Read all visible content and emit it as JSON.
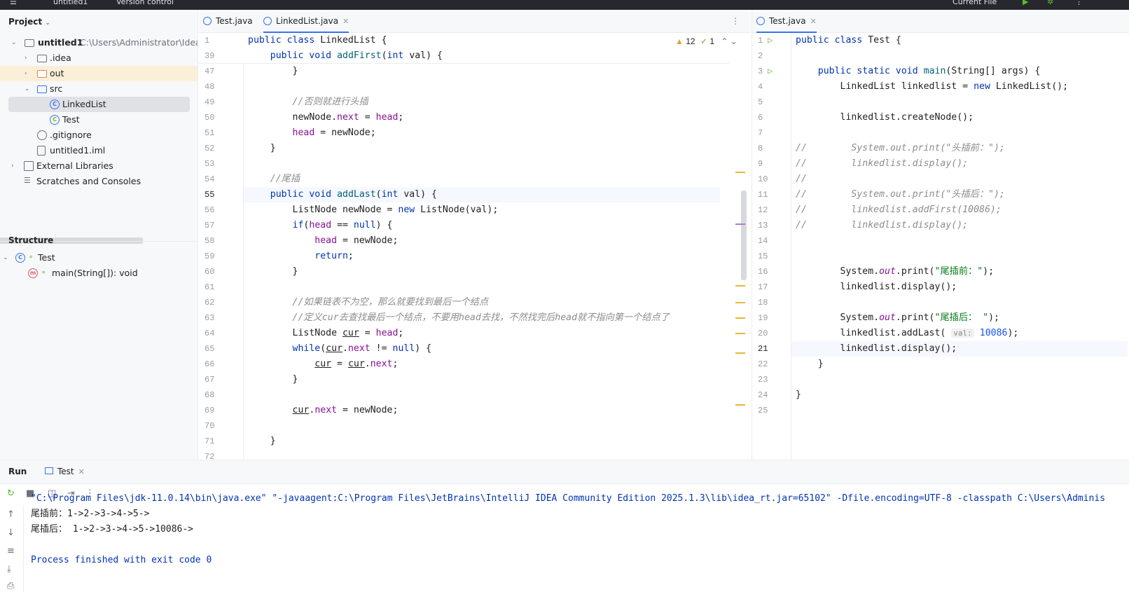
{
  "topbar": {
    "project": "untitled1",
    "vcs": "Version control",
    "run_config": "Current File"
  },
  "project": {
    "title": "Project",
    "root_name": "untitled1",
    "root_path": "C:\\Users\\Administrator\\IdeaP",
    "items": [
      ".idea",
      "out",
      "src",
      "LinkedList",
      "Test",
      ".gitignore",
      "untitled1.iml",
      "External Libraries",
      "Scratches and Consoles"
    ]
  },
  "structure": {
    "title": "Structure",
    "class": "Test",
    "method": "main(String[]): void"
  },
  "left_editor": {
    "tabs": [
      "Test.java",
      "LinkedList.java"
    ],
    "inspections": {
      "warnings": "12",
      "ok": "1"
    },
    "sticky": [
      {
        "n": "1",
        "h": "<span class='kw'>public class</span> LinkedList {"
      },
      {
        "n": "39",
        "h": "    <span class='kw'>public void</span> <span class='fn'>addFirst</span>(<span class='kw'>int</span> val) {"
      }
    ],
    "lines": [
      {
        "n": "47",
        "h": "        }"
      },
      {
        "n": "48",
        "h": ""
      },
      {
        "n": "49",
        "h": "        <span class='cmt'>//否则就进行头插</span>"
      },
      {
        "n": "50",
        "h": "        newNode.<span class='fld'>next</span> = <span class='fld'>head</span>;"
      },
      {
        "n": "51",
        "h": "        <span class='fld'>head</span> = newNode;"
      },
      {
        "n": "52",
        "h": "    }"
      },
      {
        "n": "53",
        "h": ""
      },
      {
        "n": "54",
        "h": "    <span class='cmt'>//尾插</span>"
      },
      {
        "n": "55",
        "h": "    <span class='kw'>public void</span> <span class='fn'>addLast</span>(<span class='kw'>int</span> val) {"
      },
      {
        "n": "56",
        "h": "        ListNode newNode = <span class='kw'>new</span> ListNode(val);"
      },
      {
        "n": "57",
        "h": "        <span class='kw'>if</span>(<span class='fld'>head</span> == <span class='kw'>null</span>) {"
      },
      {
        "n": "58",
        "h": "            <span class='fld'>head</span> = newNode;"
      },
      {
        "n": "59",
        "h": "            <span class='kw'>return</span>;"
      },
      {
        "n": "60",
        "h": "        }"
      },
      {
        "n": "61",
        "h": ""
      },
      {
        "n": "62",
        "h": "        <span class='cmt'>//如果链表不为空，那么就要找到最后一个结点</span>"
      },
      {
        "n": "63",
        "h": "        <span class='cmt'>//定义cur去查找最后一个结点，不要用head去找，不然找完后head就不指向第一个结点了</span>"
      },
      {
        "n": "64",
        "h": "        ListNode <span class='ul'>cur</span> = <span class='fld'>head</span>;"
      },
      {
        "n": "65",
        "h": "        <span class='kw'>while</span>(<span class='ul'>cur</span>.<span class='fld'>next</span> != <span class='kw'>null</span>) {"
      },
      {
        "n": "66",
        "h": "            <span class='ul'>cur</span> = <span class='ul'>cur</span>.<span class='fld'>next</span>;"
      },
      {
        "n": "67",
        "h": "        }"
      },
      {
        "n": "68",
        "h": ""
      },
      {
        "n": "69",
        "h": "        <span class='ul'>cur</span>.<span class='fld'>next</span> = newNode;"
      },
      {
        "n": "70",
        "h": ""
      },
      {
        "n": "71",
        "h": "    }"
      },
      {
        "n": "72",
        "h": ""
      }
    ]
  },
  "right_editor": {
    "tabs": [
      "Test.java"
    ],
    "lines": [
      {
        "n": "1",
        "h": "<span class='kw'>public class</span> Test {"
      },
      {
        "n": "2",
        "h": ""
      },
      {
        "n": "3",
        "h": "    <span class='kw'>public static void</span> <span class='fn'>main</span>(String[] args) {"
      },
      {
        "n": "4",
        "h": "        LinkedList linkedlist = <span class='kw'>new</span> LinkedList();"
      },
      {
        "n": "5",
        "h": ""
      },
      {
        "n": "6",
        "h": "        linkedlist.createNode();"
      },
      {
        "n": "7",
        "h": ""
      },
      {
        "n": "8",
        "h": "<span class='cmt'>//        System.out.print(\"头插前：\");</span>"
      },
      {
        "n": "9",
        "h": "<span class='cmt'>//        linkedlist.display();</span>"
      },
      {
        "n": "10",
        "h": "<span class='cmt'>//</span>"
      },
      {
        "n": "11",
        "h": "<span class='cmt'>//        System.out.print(\"头插后：\");</span>"
      },
      {
        "n": "12",
        "h": "<span class='cmt'>//        linkedlist.addFirst(10086);</span>"
      },
      {
        "n": "13",
        "h": "<span class='cmt'>//        linkedlist.display();</span>"
      },
      {
        "n": "14",
        "h": ""
      },
      {
        "n": "15",
        "h": ""
      },
      {
        "n": "16",
        "h": "        System.<span class='fld' style='font-style:italic'>out</span>.print(<span class='str'>\"尾插前：\"</span>);"
      },
      {
        "n": "17",
        "h": "        linkedlist.display();"
      },
      {
        "n": "18",
        "h": ""
      },
      {
        "n": "19",
        "h": "        System.<span class='fld' style='font-style:italic'>out</span>.print(<span class='str'>\"尾插后： \"</span>);"
      },
      {
        "n": "20",
        "h": "        linkedlist.addLast( <span class='hint'>val:</span> <span class='num'>10086</span>);"
      },
      {
        "n": "21",
        "h": "        linkedlist.display();"
      },
      {
        "n": "22",
        "h": "    }"
      },
      {
        "n": "23",
        "h": ""
      },
      {
        "n": "24",
        "h": "}"
      },
      {
        "n": "25",
        "h": ""
      }
    ]
  },
  "run": {
    "title": "Run",
    "tab": "Test",
    "output": [
      "\"C:\\Program Files\\jdk-11.0.14\\bin\\java.exe\" \"-javaagent:C:\\Program Files\\JetBrains\\IntelliJ IDEA Community Edition 2025.1.3\\lib\\idea_rt.jar=65102\" -Dfile.encoding=UTF-8 -classpath C:\\Users\\Adminis",
      "尾插前：1->2->3->4->5->",
      "尾插后： 1->2->3->4->5->10086->",
      "",
      "Process finished with exit code 0"
    ]
  }
}
